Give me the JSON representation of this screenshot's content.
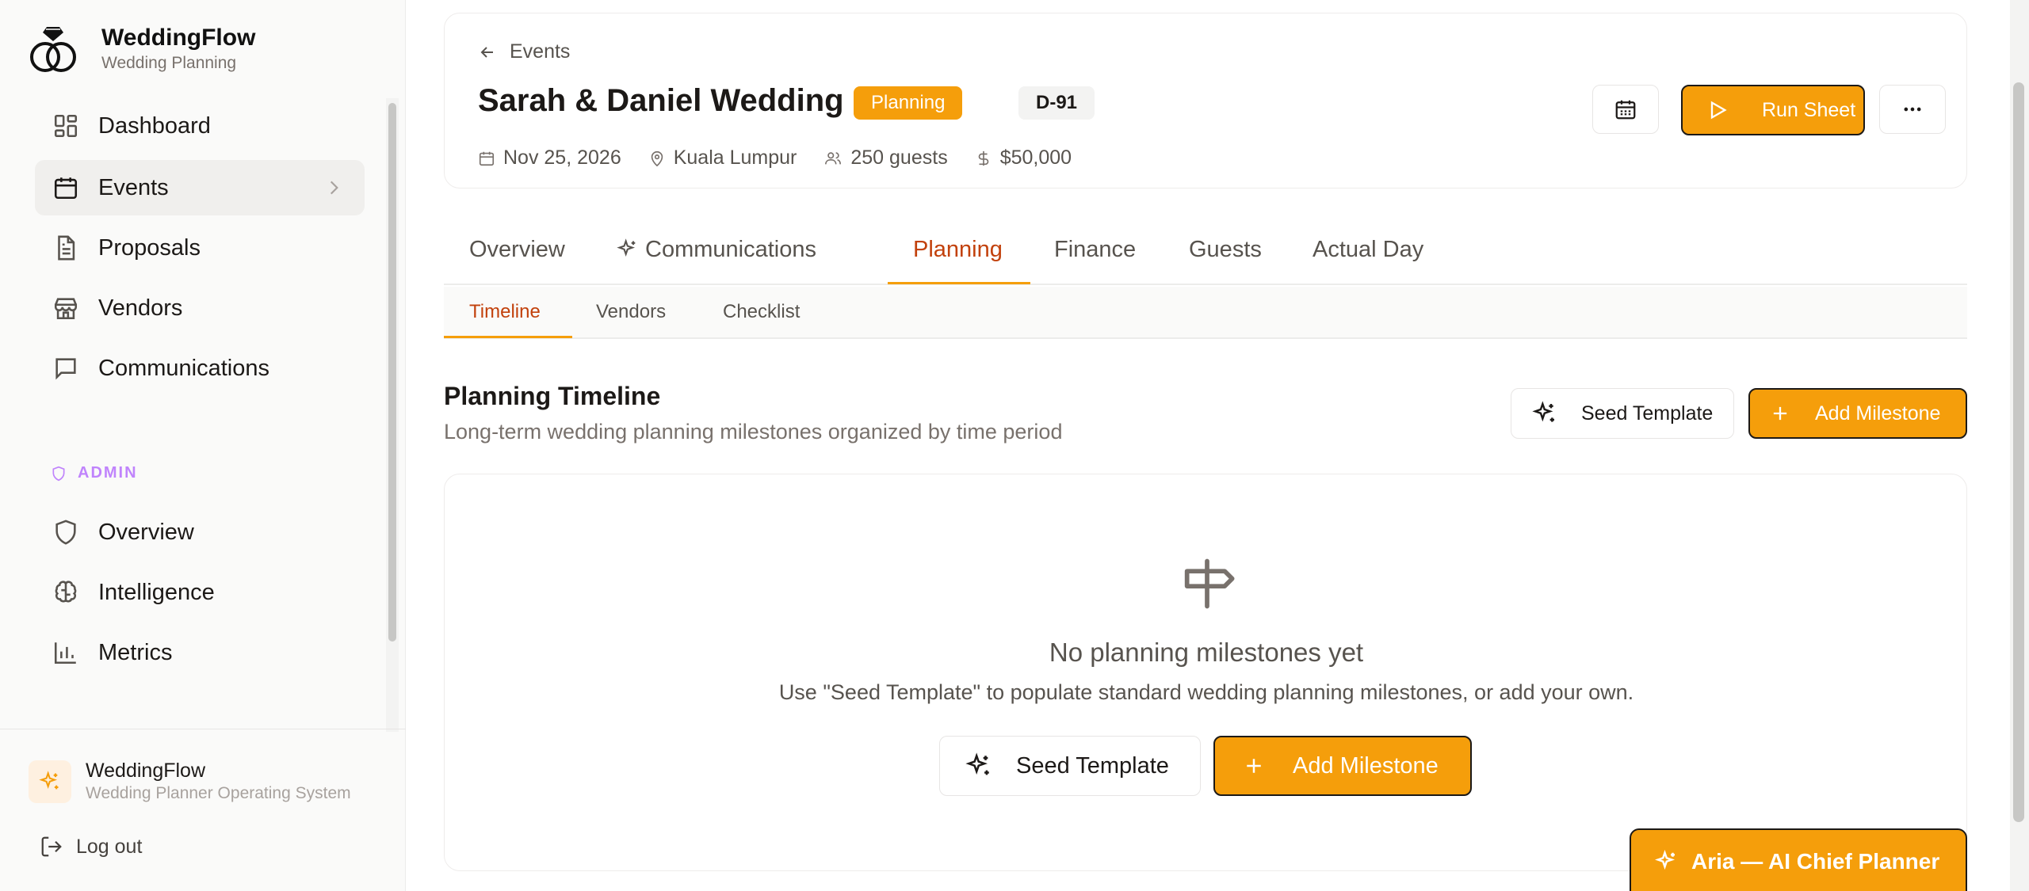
{
  "brand": {
    "name": "WeddingFlow",
    "subtitle": "Wedding Planning"
  },
  "sidebar": {
    "items": [
      {
        "label": "Dashboard",
        "icon": "dashboard-icon"
      },
      {
        "label": "Events",
        "icon": "calendar-icon",
        "active": true
      },
      {
        "label": "Proposals",
        "icon": "document-icon"
      },
      {
        "label": "Vendors",
        "icon": "store-icon"
      },
      {
        "label": "Communications",
        "icon": "chat-icon"
      }
    ],
    "admin_label": "ADMIN",
    "admin_items": [
      {
        "label": "Overview",
        "icon": "shield-icon"
      },
      {
        "label": "Intelligence",
        "icon": "brain-icon"
      },
      {
        "label": "Metrics",
        "icon": "bar-chart-icon"
      }
    ],
    "footer": {
      "name": "WeddingFlow",
      "subtitle": "Wedding Planner Operating System"
    },
    "logout": "Log out"
  },
  "header": {
    "back_label": "Events",
    "title": "Sarah & Daniel Wedding",
    "status_badge": "Planning",
    "countdown_badge": "D-91",
    "date": "Nov 25, 2026",
    "location": "Kuala Lumpur",
    "guests": "250 guests",
    "budget": "$50,000",
    "run_sheet_label": "Run Sheet"
  },
  "tabs": [
    {
      "label": "Overview"
    },
    {
      "label": "Communications"
    },
    {
      "label": "Planning",
      "active": true
    },
    {
      "label": "Finance"
    },
    {
      "label": "Guests"
    },
    {
      "label": "Actual Day"
    }
  ],
  "subtabs": [
    {
      "label": "Timeline",
      "active": true
    },
    {
      "label": "Vendors"
    },
    {
      "label": "Checklist"
    }
  ],
  "planning": {
    "title": "Planning Timeline",
    "description": "Long-term wedding planning milestones organized by time period",
    "seed_label": "Seed Template",
    "add_label": "Add Milestone",
    "empty_title": "No planning milestones yet",
    "empty_desc": "Use \"Seed Template\" to populate standard wedding planning milestones, or add your own."
  },
  "aria": {
    "label": "Aria — AI Chief Planner"
  },
  "colors": {
    "accent": "#f59e0b",
    "accent_text": "#c2410c",
    "admin": "#c084fc"
  }
}
